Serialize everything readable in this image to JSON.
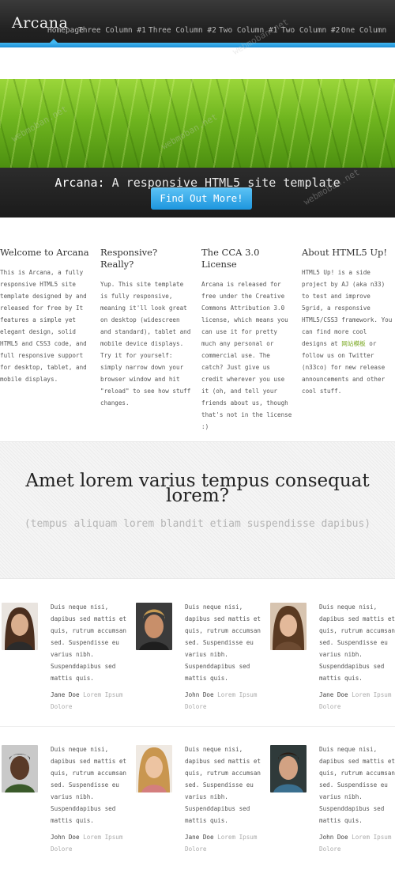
{
  "header": {
    "brand": "Arcana",
    "nav": [
      "Homepage",
      "Three Column #1",
      "Three Column #2",
      "Two Column #1",
      "Two Column #2",
      "One Column"
    ]
  },
  "banner": {
    "title_strong": "Arcana:",
    "title_rest": " A responsive HTML5 site template",
    "button": "Find Out More!"
  },
  "features": [
    {
      "title": "Welcome to Arcana",
      "text": "This is Arcana, a fully responsive HTML5 site template designed by and released for free by It features a simple yet elegant design, solid HTML5 and CSS3 code, and full responsive support for desktop, tablet, and mobile displays."
    },
    {
      "title": "Responsive? Really?",
      "text": "Yup. This site template is fully responsive, meaning it'll look great on desktop (widescreen and standard), tablet and mobile device displays. Try it for yourself: simply narrow down your browser window and hit \"reload\" to see how stuff changes."
    },
    {
      "title": "The CCA 3.0 License",
      "text": "Arcana is released for free under the Creative Commons Attribution 3.0 license, which means you can use it for pretty much any personal or commercial use. The catch? Just give us credit wherever you use it (oh, and tell your friends about us, though that's not in the license :)"
    },
    {
      "title": "About HTML5 Up!",
      "text_before": "HTML5 Up! is a side project by AJ (aka n33) to test and improve 5grid, a responsive HTML5/CSS3 framework. You can find more cool designs at ",
      "link": "网站模板",
      "text_after": " or follow us on Twitter (n33co) for new release announcements and other cool stuff."
    }
  ],
  "band": {
    "heading": "Amet lorem varius tempus consequat lorem?",
    "subheading": "(tempus aliquam lorem blandit etiam suspendisse dapibus)"
  },
  "testimonials": {
    "text": "Duis neque nisi, dapibus sed mattis et quis, rutrum accumsan sed. Suspendisse eu varius nibh. Suspenddapibus sed mattis quis.",
    "name": "Jane Doe",
    "name_alt": "John Doe",
    "role": "Lorem Ipsum Dolore"
  },
  "watermark": "webmoban.net"
}
